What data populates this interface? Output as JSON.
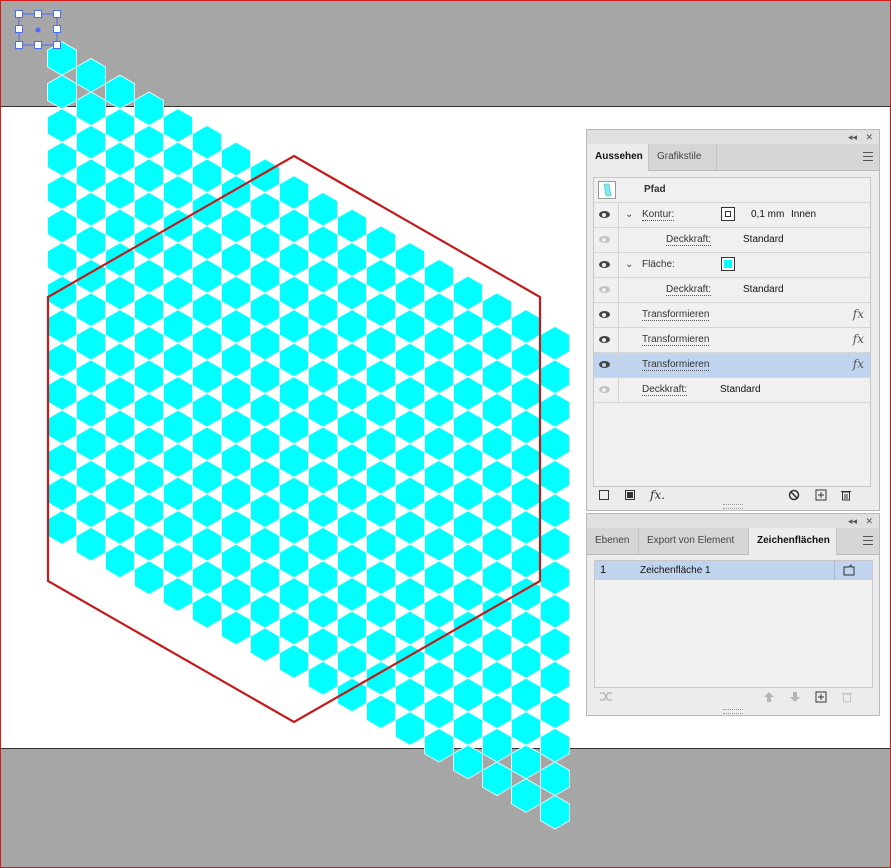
{
  "colors": {
    "hex_fill": "#00ffff",
    "boundary": "#c31b1b",
    "artboard": "#ffffff",
    "pasteboard": "#a6a6a6",
    "selection": "#4a6cf0"
  },
  "appearance_panel": {
    "tabs": [
      {
        "label": "Aussehen",
        "active": true
      },
      {
        "label": "Grafikstile",
        "active": false
      }
    ],
    "object_label": "Pfad",
    "rows": [
      {
        "type": "stroke",
        "label": "Kontur:",
        "value": "0,1 mm",
        "position": "Innen"
      },
      {
        "type": "sub",
        "label": "Deckkraft:",
        "value": "Standard"
      },
      {
        "type": "fill",
        "label": "Fläche:",
        "swatch_color": "#00ffff"
      },
      {
        "type": "sub",
        "label": "Deckkraft:",
        "value": "Standard"
      },
      {
        "type": "effect",
        "label": "Transformieren"
      },
      {
        "type": "effect",
        "label": "Transformieren"
      },
      {
        "type": "effect",
        "label": "Transformieren",
        "selected": true
      },
      {
        "type": "opacity",
        "label": "Deckkraft:",
        "value": "Standard"
      }
    ],
    "fx_label": "fx",
    "bottom_fx_label": "fx."
  },
  "artboards_panel": {
    "tabs": [
      {
        "label": "Ebenen",
        "active": false
      },
      {
        "label": "Export von Element",
        "active": false
      },
      {
        "label": "Zeichenflächen",
        "active": true
      }
    ],
    "items": [
      {
        "number": "1",
        "name": "Zeichenfläche 1",
        "selected": true
      }
    ]
  },
  "titlebar": {
    "collapse": "◂◂",
    "close": "✕"
  }
}
